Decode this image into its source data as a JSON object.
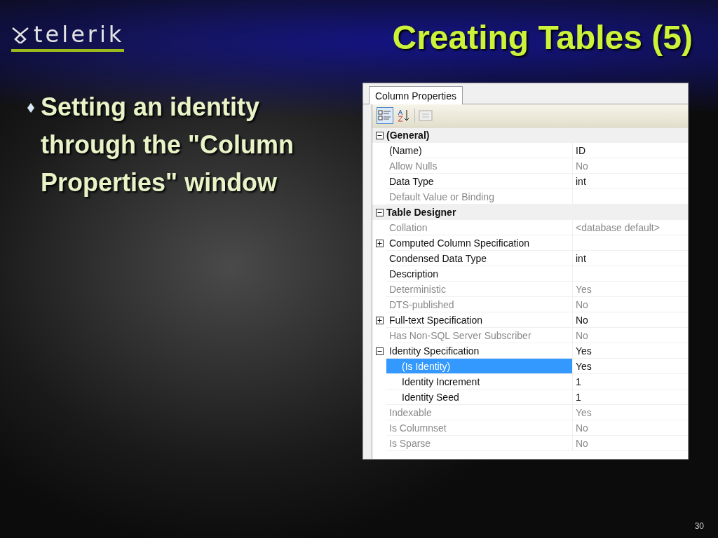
{
  "logo": {
    "text": "telerik"
  },
  "title": "Creating Tables (5)",
  "bullets": [
    "Setting an identity through the \"Column Properties\" window"
  ],
  "panel": {
    "tab": "Column Properties",
    "toolbar": [
      {
        "kind": "categorized",
        "selected": true
      },
      {
        "kind": "alphabetical",
        "selected": false
      },
      {
        "kind": "pages",
        "selected": false
      }
    ],
    "categories": [
      {
        "name": "(General)",
        "expanded": true,
        "rows": [
          {
            "name": "(Name)",
            "value": "ID",
            "disabled": false,
            "selected": false
          },
          {
            "name": "Allow Nulls",
            "value": "No",
            "disabled": true,
            "selected": false
          },
          {
            "name": "Data Type",
            "value": "int",
            "disabled": false,
            "selected": false
          },
          {
            "name": "Default Value or Binding",
            "disabled": true,
            "selected": false
          }
        ]
      },
      {
        "name": "Table Designer",
        "expanded": true,
        "rows": [
          {
            "name": "Collation",
            "value": "<database default>",
            "disabled": true,
            "selected": false
          },
          {
            "name": "Computed Column Specification",
            "disabled": false,
            "selected": false,
            "expanded": false
          },
          {
            "name": "Condensed Data Type",
            "value": "int",
            "disabled": false,
            "selected": false
          },
          {
            "name": "Description",
            "disabled": false,
            "selected": false
          },
          {
            "name": "Deterministic",
            "value": "Yes",
            "disabled": true,
            "selected": false
          },
          {
            "name": "DTS-published",
            "value": "No",
            "disabled": true,
            "selected": false
          },
          {
            "name": "Full-text Specification",
            "value": "No",
            "disabled": false,
            "selected": false,
            "expanded": false
          },
          {
            "name": "Has Non-SQL Server Subscriber",
            "value": "No",
            "disabled": true,
            "selected": false
          },
          {
            "name": "Identity Specification",
            "value": "Yes",
            "disabled": false,
            "selected": false,
            "expanded": true,
            "children": [
              {
                "name": "(Is Identity)",
                "value": "Yes",
                "disabled": false,
                "selected": true
              },
              {
                "name": "Identity Increment",
                "value": "1",
                "disabled": false,
                "selected": false
              },
              {
                "name": "Identity Seed",
                "value": "1",
                "disabled": false,
                "selected": false
              }
            ]
          },
          {
            "name": "Indexable",
            "value": "Yes",
            "disabled": true,
            "selected": false
          },
          {
            "name": "Is Columnset",
            "value": "No",
            "disabled": true,
            "selected": false
          },
          {
            "name": "Is Sparse",
            "value": "No",
            "disabled": true,
            "selected": false
          }
        ]
      }
    ]
  },
  "page_number": "30"
}
